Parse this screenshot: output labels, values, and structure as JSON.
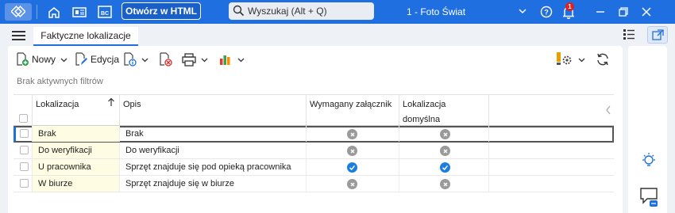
{
  "topbar": {
    "open_html_label": "Otwórz w HTML",
    "search_placeholder": "Wyszukaj (Alt + Q)",
    "company_name": "1 - Foto Świat",
    "notification_count": "1",
    "icons": [
      "app-icon",
      "home-icon",
      "document-icon",
      "bc-icon",
      "search-icon",
      "chevron-down-icon",
      "help-icon",
      "bell-icon",
      "minimize-icon",
      "restore-icon",
      "close-icon"
    ],
    "bc_label": "BC"
  },
  "tabs": {
    "active_label": "Faktyczne lokalizacje"
  },
  "toolbar": {
    "new_label": "Nowy",
    "edit_label": "Edycja"
  },
  "filters": {
    "status": "Brak aktywnych filtrów"
  },
  "table": {
    "columns": {
      "lokalizacja": "Lokalizacja",
      "opis": "Opis",
      "wymagany": "Wymagany załącznik",
      "domyslna_line1": "Lokalizacja",
      "domyslna_line2": "domyślna"
    },
    "rows": [
      {
        "lokalizacja": "Brak",
        "opis": "Brak",
        "wymagany": false,
        "domyslna": false
      },
      {
        "lokalizacja": "Do weryfikacji",
        "opis": "Do weryfikacji",
        "wymagany": false,
        "domyslna": false
      },
      {
        "lokalizacja": "U pracownika",
        "opis": "Sprzęt znajduje się pod opieką pracownika",
        "wymagany": true,
        "domyslna": true
      },
      {
        "lokalizacja": "W biurze",
        "opis": "Sprzęt znajduje się w biurze",
        "wymagany": false,
        "domyslna": false
      }
    ]
  },
  "colors": {
    "accent": "#1f6fe0",
    "checked": "#1a7ee0",
    "unchecked": "#9a9a9a",
    "lokalizacja_cell_bg": "#fefde3"
  }
}
